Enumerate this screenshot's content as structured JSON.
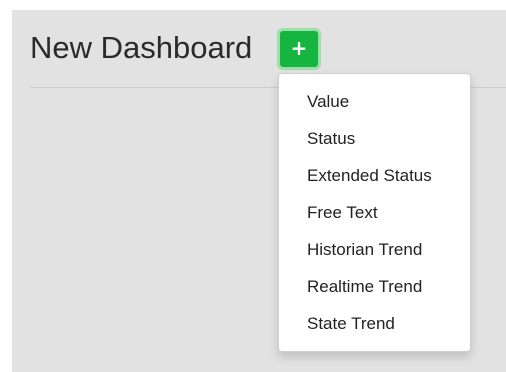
{
  "dashboard": {
    "title": "New Dashboard",
    "add_button": {
      "icon": "plus-icon",
      "glyph": "+",
      "color": "#16b53f"
    }
  },
  "add_menu": {
    "items": [
      {
        "label": "Value"
      },
      {
        "label": "Status"
      },
      {
        "label": "Extended Status"
      },
      {
        "label": "Free Text"
      },
      {
        "label": "Historian Trend"
      },
      {
        "label": "Realtime Trend"
      },
      {
        "label": "State Trend"
      }
    ]
  }
}
